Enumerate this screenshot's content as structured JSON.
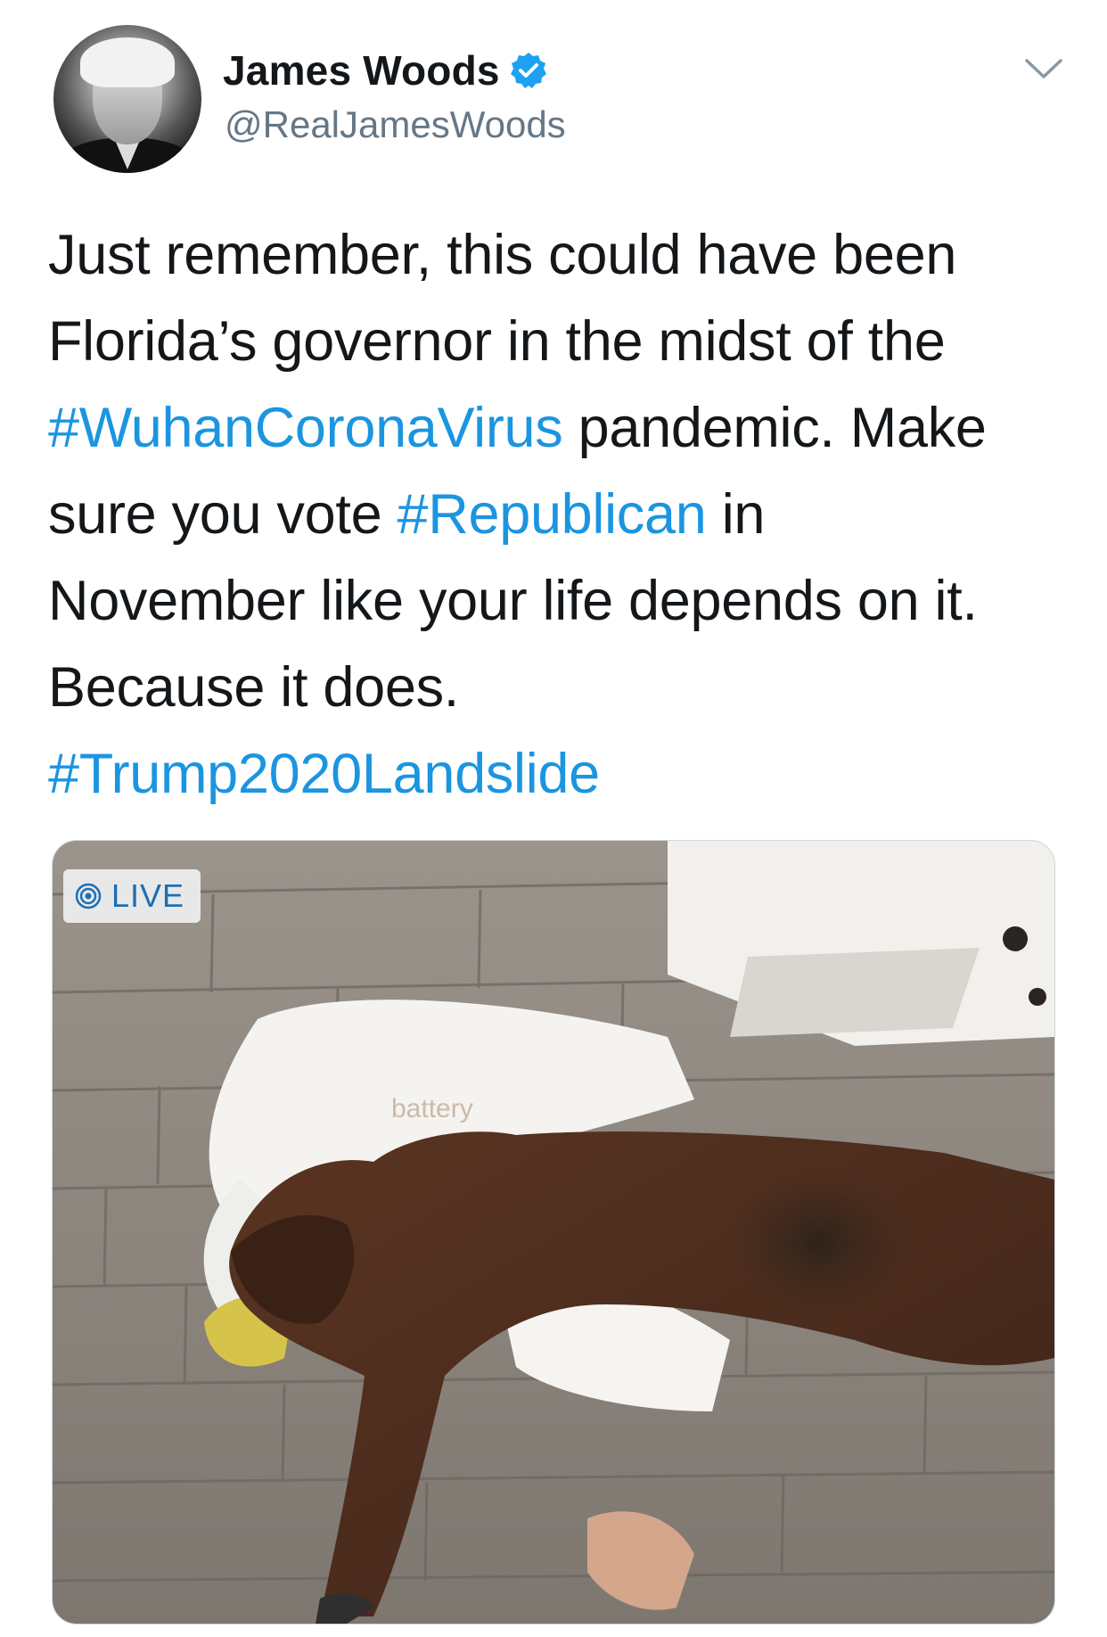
{
  "author": {
    "display_name": "James Woods",
    "handle": "@RealJamesWoods",
    "verified": true
  },
  "tweet": {
    "lines": [
      [
        {
          "text": "Just remember, this could have been",
          "hashtag": false
        }
      ],
      [
        {
          "text": "Florida’s governor in the midst of the",
          "hashtag": false
        }
      ],
      [
        {
          "text": "#WuhanCoronaVirus",
          "hashtag": true
        },
        {
          "text": " pandemic. Make",
          "hashtag": false
        }
      ],
      [
        {
          "text": "sure you vote ",
          "hashtag": false
        },
        {
          "text": "#Republican",
          "hashtag": true
        },
        {
          "text": " in",
          "hashtag": false
        }
      ],
      [
        {
          "text": "November like your life depends on it.",
          "hashtag": false
        }
      ],
      [
        {
          "text": "Because it does.",
          "hashtag": false
        }
      ],
      [
        {
          "text": "#Trump2020Landslide",
          "hashtag": true
        }
      ]
    ]
  },
  "media": {
    "badge_label": "LIVE"
  },
  "icons": {
    "verified": "verified-badge-icon",
    "more": "chevron-down-icon",
    "live": "live-broadcast-icon"
  },
  "colors": {
    "hashtag": "#1b95e0",
    "text": "#14171a",
    "secondary": "#657786",
    "verified": "#1da1f2"
  }
}
